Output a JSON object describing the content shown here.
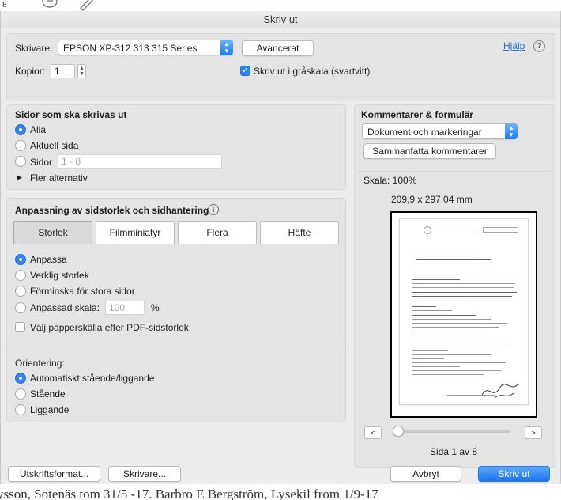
{
  "background": {
    "top_number": "8",
    "bottom_text": "ysson, Sotenäs tom 31/5 -17. Barbro E Bergström, Lysekil from 1/9-17"
  },
  "dialog": {
    "title": "Skriv ut",
    "printer_label": "Skrivare:",
    "printer_value": "EPSON XP-312 313 315 Series",
    "advanced_button": "Avancerat",
    "help_link": "Hjälp",
    "copies_label": "Kopior:",
    "copies_value": "1",
    "grayscale_label": "Skriv ut i gråskala (svartvitt)",
    "grayscale_checked": true
  },
  "pages": {
    "heading": "Sidor som ska skrivas ut",
    "all": "Alla",
    "current": "Aktuell sida",
    "range": "Sidor",
    "range_placeholder": "1 - 8",
    "more": "Fler alternativ",
    "selected": "all"
  },
  "sizing": {
    "heading": "Anpassning av sidstorlek och sidhantering",
    "tabs": [
      "Storlek",
      "Filmminiatyr",
      "Flera",
      "Häfte"
    ],
    "selected_tab": "Storlek",
    "options": [
      "Anpassa",
      "Verklig storlek",
      "Förminska för stora sidor",
      "Anpassad skala:"
    ],
    "selected_option": "Anpassa",
    "scale_placeholder": "100",
    "percent": "%",
    "paper_source": "Välj papperskälla efter PDF-sidstorlek"
  },
  "orientation": {
    "heading": "Orientering:",
    "options": [
      "Automatiskt stående/liggande",
      "Stående",
      "Liggande"
    ],
    "selected": "Automatiskt stående/liggande"
  },
  "comments": {
    "heading": "Kommentarer & formulär",
    "value": "Dokument och markeringar",
    "summarize_button": "Sammanfatta kommentarer"
  },
  "preview": {
    "scale": "Skala: 100%",
    "dimensions": "209,9 x 297,04 mm",
    "prev": "<",
    "next": ">",
    "page_info": "Sida 1 av 8",
    "slider_position": 0
  },
  "footer": {
    "page_setup": "Utskriftsformat...",
    "printer": "Skrivare...",
    "cancel": "Avbryt",
    "print": "Skriv ut"
  },
  "colors": {
    "accent": "#1c7cf2",
    "link": "#2d6bd6"
  }
}
